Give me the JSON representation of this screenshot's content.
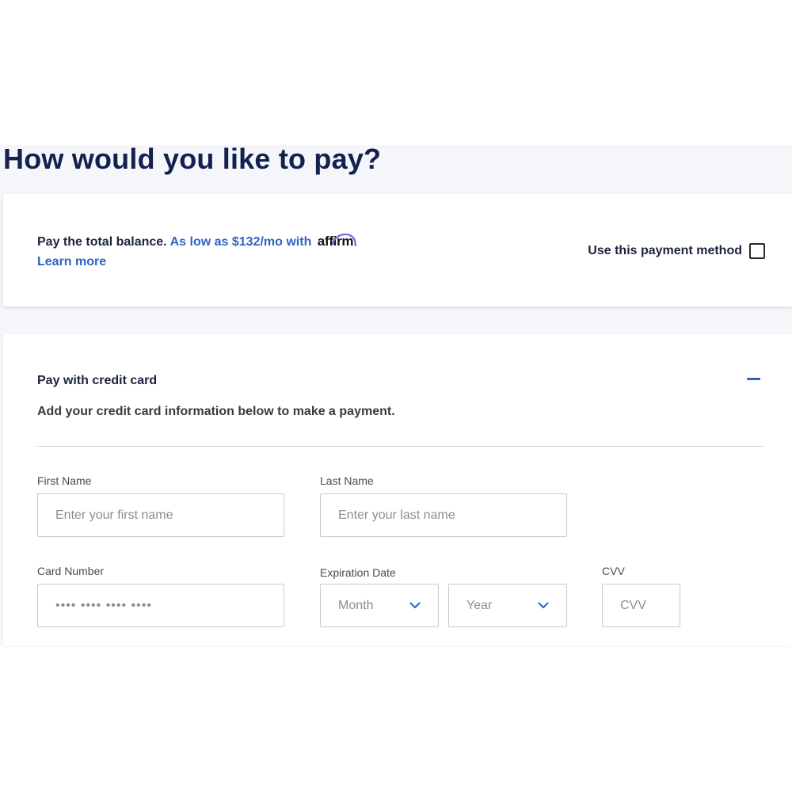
{
  "page": {
    "title": "How would you like to pay?"
  },
  "affirm": {
    "lead": "Pay the total balance.",
    "offer": "As low as $132/mo with",
    "logo_text": "affirm",
    "learn_more": "Learn more",
    "use_method_label": "Use this payment method",
    "use_method_checked": false
  },
  "credit_card": {
    "title": "Pay with credit card",
    "collapse_icon": "minus-icon",
    "description": "Add your credit card information below to make a payment.",
    "first_name": {
      "label": "First Name",
      "placeholder": "Enter your first name",
      "value": ""
    },
    "last_name": {
      "label": "Last Name",
      "placeholder": "Enter your last name",
      "value": ""
    },
    "card_number": {
      "label": "Card Number",
      "placeholder": "•••• •••• •••• ••••",
      "value": ""
    },
    "expiration": {
      "label": "Expiration Date",
      "month": {
        "selected": "Month",
        "icon": "chevron-down-icon"
      },
      "year": {
        "selected": "Year",
        "icon": "chevron-down-icon"
      }
    },
    "cvv": {
      "label": "CVV",
      "placeholder": "CVV",
      "value": ""
    }
  },
  "colors": {
    "title": "#14214f",
    "link": "#2f62c4",
    "background": "#f4f6f9",
    "border": "#c7cad1"
  }
}
